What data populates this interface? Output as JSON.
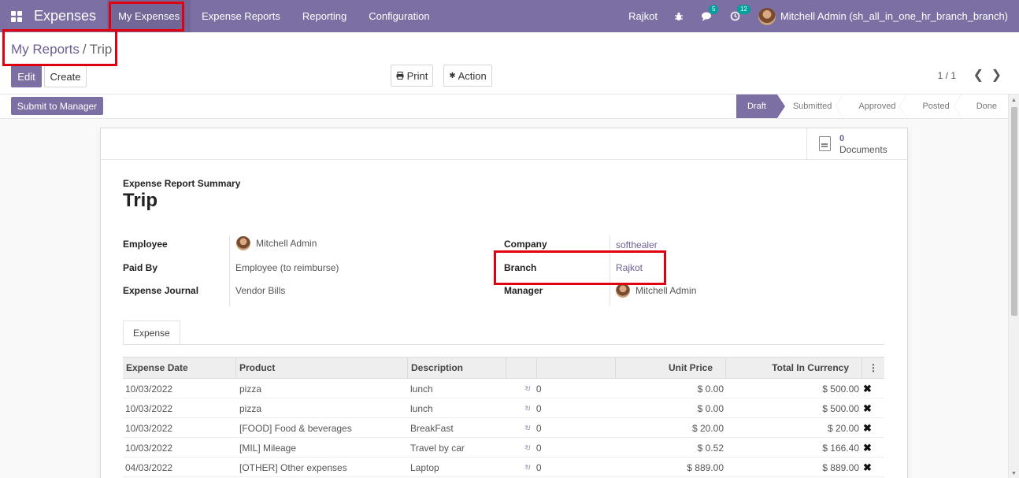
{
  "navbar": {
    "app_name": "Expenses",
    "menu": [
      "My Expenses",
      "Expense Reports",
      "Reporting",
      "Configuration"
    ],
    "city": "Rajkot",
    "chat_badge": "5",
    "activity_badge": "12",
    "user": "Mitchell Admin (sh_all_in_one_hr_branch_branch)",
    "accent_color": "#7c6fa3"
  },
  "breadcrumb": {
    "parent": "My Reports",
    "separator": "/",
    "current": "Trip"
  },
  "buttons": {
    "edit": "Edit",
    "create": "Create",
    "print": "Print",
    "action": "Action",
    "submit": "Submit to Manager"
  },
  "pager": {
    "text": "1 / 1"
  },
  "status": {
    "steps": [
      "Draft",
      "Submitted",
      "Approved",
      "Posted",
      "Done"
    ],
    "active": "Draft"
  },
  "sheet": {
    "documents_count": "0",
    "documents_label": "Documents",
    "summary_label": "Expense Report Summary",
    "title": "Trip",
    "fields_left": [
      {
        "label": "Employee",
        "value": "Mitchell Admin"
      },
      {
        "label": "Paid By",
        "value": "Employee (to reimburse)"
      },
      {
        "label": "Expense Journal",
        "value": "Vendor Bills"
      }
    ],
    "fields_right": [
      {
        "label": "Company",
        "value": "softhealer"
      },
      {
        "label": "Branch",
        "value": "Rajkot"
      },
      {
        "label": "Manager",
        "value": "Mitchell Admin"
      }
    ],
    "tab": "Expense",
    "table": {
      "headers": [
        "Expense Date",
        "Product",
        "Description",
        "",
        "",
        "Unit Price",
        "Total In Currency"
      ],
      "rows": [
        {
          "date": "10/03/2022",
          "product": "pizza",
          "description": "lunch",
          "attachments": "0",
          "unit_price": "$ 0.00",
          "total": "$ 500.00"
        },
        {
          "date": "10/03/2022",
          "product": "pizza",
          "description": "lunch",
          "attachments": "0",
          "unit_price": "$ 0.00",
          "total": "$ 500.00"
        },
        {
          "date": "10/03/2022",
          "product": "[FOOD] Food & beverages",
          "description": "BreakFast",
          "attachments": "0",
          "unit_price": "$ 20.00",
          "total": "$ 20.00"
        },
        {
          "date": "10/03/2022",
          "product": "[MIL] Mileage",
          "description": "Travel by car",
          "attachments": "0",
          "unit_price": "$ 0.52",
          "total": "$ 166.40"
        },
        {
          "date": "04/03/2022",
          "product": "[OTHER] Other expenses",
          "description": "Laptop",
          "attachments": "0",
          "unit_price": "$ 889.00",
          "total": "$ 889.00"
        }
      ]
    }
  }
}
